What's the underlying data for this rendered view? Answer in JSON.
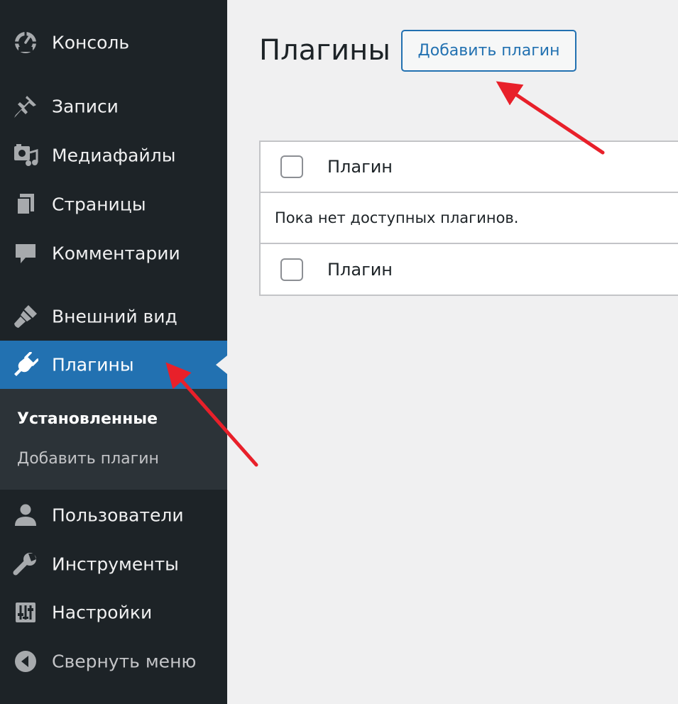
{
  "sidebar": {
    "items": [
      {
        "label": "Консоль",
        "icon": "dashboard-icon"
      },
      {
        "label": "Записи",
        "icon": "pin-icon"
      },
      {
        "label": "Медиафайлы",
        "icon": "media-icon"
      },
      {
        "label": "Страницы",
        "icon": "pages-icon"
      },
      {
        "label": "Комментарии",
        "icon": "comment-icon"
      },
      {
        "label": "Внешний вид",
        "icon": "paintbrush-icon"
      },
      {
        "label": "Плагины",
        "icon": "plugin-icon",
        "current": true
      },
      {
        "label": "Пользователи",
        "icon": "user-icon"
      },
      {
        "label": "Инструменты",
        "icon": "wrench-icon"
      },
      {
        "label": "Настройки",
        "icon": "settings-sliders-icon"
      },
      {
        "label": "Свернуть меню",
        "icon": "collapse-arrow-icon"
      }
    ],
    "submenu": [
      {
        "label": "Установленные",
        "active": true
      },
      {
        "label": "Добавить плагин"
      }
    ]
  },
  "main": {
    "title": "Плагины",
    "add_button": "Добавить плагин",
    "table": {
      "column": "Плагин",
      "empty_message": "Пока нет доступных плагинов.",
      "footer_column": "Плагин"
    }
  },
  "colors": {
    "sidebar_bg": "#1d2327",
    "submenu_bg": "#2c3338",
    "accent": "#2271b1",
    "page_bg": "#f0f0f1",
    "annotation_arrow": "#e8202a"
  }
}
